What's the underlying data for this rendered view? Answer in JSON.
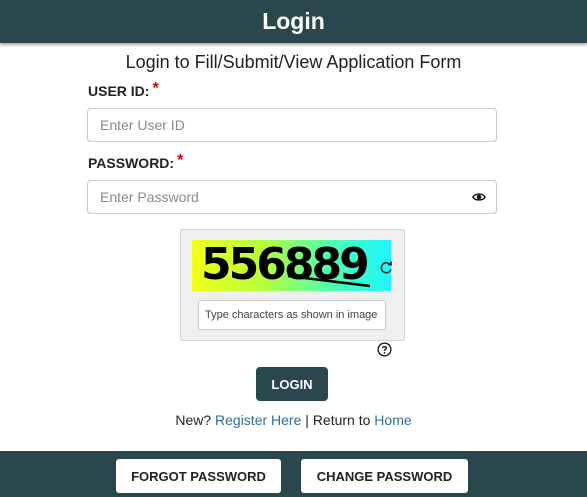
{
  "header": {
    "title": "Login"
  },
  "subtitle": "Login to Fill/Submit/View Application Form",
  "user_id": {
    "label": "USER ID:",
    "required_mark": "*",
    "placeholder": "Enter User ID",
    "value": ""
  },
  "password": {
    "label": "PASSWORD:",
    "required_mark": "*",
    "placeholder": "Enter Password",
    "value": "",
    "toggle_icon": "eye-icon"
  },
  "captcha": {
    "text": "556889",
    "input_placeholder": "Type characters as shown in image",
    "refresh_icon": "refresh-icon",
    "help_icon": "question-circle-icon"
  },
  "login_button": "LOGIN",
  "links": {
    "new_prefix": "New?",
    "register": "Register Here",
    "separator": "|",
    "return_prefix": "Return to",
    "home": "Home"
  },
  "footer": {
    "forgot_password": "FORGOT PASSWORD",
    "change_password": "CHANGE PASSWORD"
  },
  "colors": {
    "primary": "#2a474e",
    "link": "#2e6f9e",
    "required": "#d40000"
  }
}
